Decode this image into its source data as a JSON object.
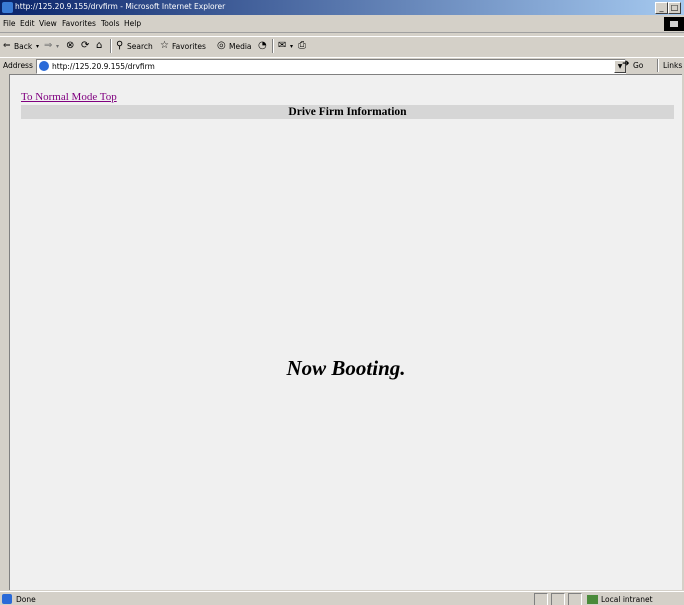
{
  "window": {
    "title": "http://125.20.9.155/drvfirm - Microsoft Internet Explorer",
    "controls": [
      "_",
      "□"
    ]
  },
  "menu": {
    "items": [
      "File",
      "Edit",
      "View",
      "Favorites",
      "Tools",
      "Help"
    ]
  },
  "toolbar": {
    "back_label": "Back",
    "search_label": "Search",
    "favorites_label": "Favorites",
    "media_label": "Media"
  },
  "address": {
    "label": "Address",
    "url": "http://125.20.9.155/drvfirm",
    "go_label": "Go",
    "links_label": "Links"
  },
  "page": {
    "normal_mode_link": "To Normal Mode Top",
    "header": "Drive Firm Information",
    "status_message": "Now Booting."
  },
  "statusbar": {
    "text": "Done",
    "zone": "Local intranet"
  }
}
